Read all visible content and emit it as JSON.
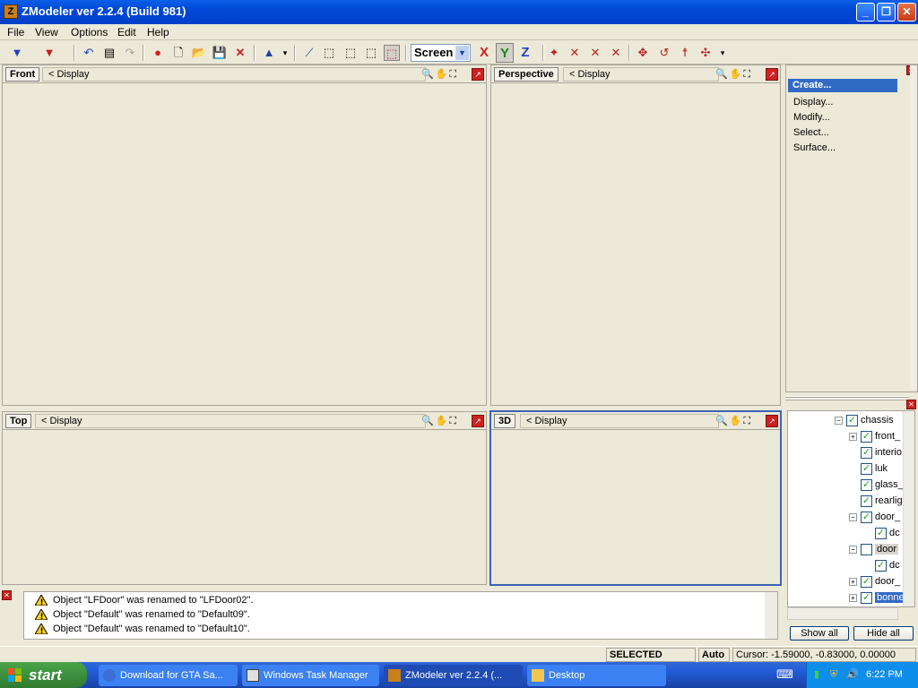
{
  "window": {
    "title": "ZModeler ver 2.2.4 (Build 981)",
    "app_icon": "Z"
  },
  "menu": [
    "File",
    "View",
    "Options",
    "Edit",
    "Help"
  ],
  "toolbar": {
    "screen_select": "Screen",
    "axes": [
      "X",
      "Y",
      "Z"
    ],
    "axis_colors": [
      "#d02020",
      "#208020",
      "#2040c0"
    ]
  },
  "viewports": [
    {
      "title": "Front",
      "display": "< Display"
    },
    {
      "title": "Perspective",
      "display": "< Display"
    },
    {
      "title": "Top",
      "display": "< Display"
    },
    {
      "title": "3D",
      "display": "< Display"
    }
  ],
  "command_panel": {
    "selected": "Create...",
    "items": [
      "Display...",
      "Modify...",
      "Select...",
      "Surface..."
    ]
  },
  "hierarchy": {
    "nodes": [
      {
        "label": "chassis",
        "checked": true,
        "expand": "−"
      },
      {
        "label": "front_",
        "checked": true,
        "expand": "+"
      },
      {
        "label": "interio",
        "checked": true,
        "expand": ""
      },
      {
        "label": "luk",
        "checked": true,
        "expand": ""
      },
      {
        "label": "glass_",
        "checked": true,
        "expand": ""
      },
      {
        "label": "rearlig",
        "checked": true,
        "expand": ""
      },
      {
        "label": "door_",
        "checked": true,
        "expand": "−"
      },
      {
        "label": "dc",
        "checked": true,
        "expand": ""
      },
      {
        "label": "door",
        "checked": false,
        "expand": "−"
      },
      {
        "label": "dc",
        "checked": true,
        "expand": ""
      },
      {
        "label": "door_",
        "checked": true,
        "expand": "+"
      },
      {
        "label": "bonne",
        "checked": true,
        "expand": "+"
      }
    ],
    "show_all": "Show all",
    "hide_all": "Hide all"
  },
  "log": [
    "Object \"LFDoor\" was renamed to \"LFDoor02\".",
    "Object \"Default\" was renamed to \"Default09\".",
    "Object \"Default\" was renamed to \"Default10\"."
  ],
  "status": {
    "mode": "SELECTED MODE",
    "auto": "Auto",
    "cursor": "Cursor: -1.59000, -0.83000, 0.00000"
  },
  "taskbar": {
    "start": "start",
    "tasks": [
      "Download for GTA Sa...",
      "Windows Task Manager",
      "ZModeler ver 2.2.4 (...",
      "Desktop"
    ],
    "clock": "6:22 PM"
  }
}
